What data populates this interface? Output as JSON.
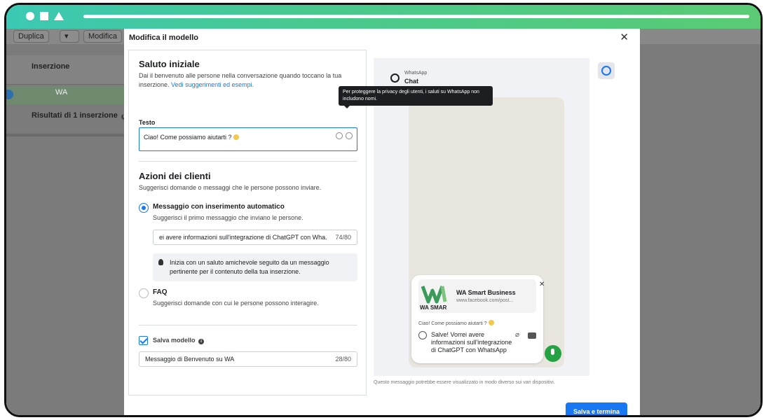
{
  "background": {
    "toolbar": {
      "duplicate_label": "Duplica",
      "edit_label": "Modifica"
    },
    "table_header": "Inserzione",
    "row_label": "WA",
    "results_label": "Risultati di 1 inserzione"
  },
  "modal": {
    "title": "Modifica il modello",
    "greeting": {
      "title": "Saluto iniziale",
      "description": "Dai il benvenuto alle persone nella conversazione quando toccano la tua inserzione.",
      "link": "Vedi suggerimenti ed esempi.",
      "field_label": "Testo",
      "field_value": "Ciao! Come possiamo aiutarti ?",
      "tooltip": "Per proteggere la privacy degli utenti, i saluti su WhatsApp non includono nomi."
    },
    "actions": {
      "title": "Azioni dei clienti",
      "description": "Suggerisci domande o messaggi che le persone possono inviare.",
      "option1_title": "Messaggio con inserimento automatico",
      "option1_desc": "Suggerisci il primo messaggio che inviano le persone.",
      "option1_value": "ei avere informazioni sull'integrazione di ChatGPT con Wha...",
      "option1_count": "74/80",
      "tip": "Inizia con un saluto amichevole seguito da un messaggio pertinente per il contenuto della tua inserzione.",
      "option2_title": "FAQ",
      "option2_desc": "Suggerisci domande con cui le persone possono interagire."
    },
    "template": {
      "save_label": "Salva modello",
      "name_value": "Messaggio di Benvenuto su WA",
      "name_count": "28/80"
    },
    "preview": {
      "app_label": "WhatsApp",
      "chat_label": "Chat",
      "business_name": "WA Smart Business",
      "business_url": "www.facebook.com/post...",
      "logo_text": "WA SMAR",
      "greeting_text": "Ciao! Come possiamo aiutarti ?",
      "message": "Salve! Vorrei avere informazioni sull'integrazione di ChatGPT con WhatsApp",
      "note": "Questo messaggio potrebbe essere visualizzato in modo diverso sui vari dispositivi."
    },
    "submit_label": "Salva e termina"
  },
  "colors": {
    "accent": "#1877f2",
    "whatsapp_green": "#25a244",
    "chrome_gradient_start": "#3cc9b4"
  }
}
